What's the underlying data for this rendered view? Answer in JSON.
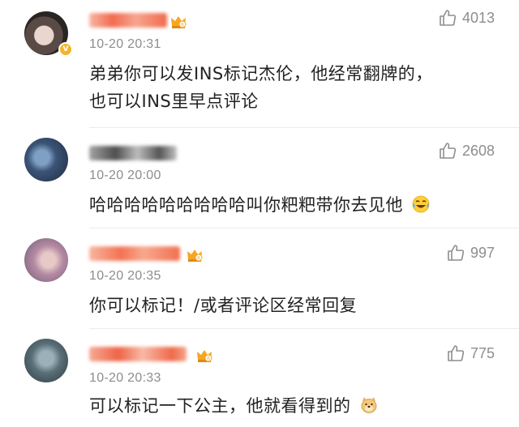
{
  "comments": [
    {
      "time": "10-20 20:31",
      "likes": "4013",
      "text_lines": [
        "弟弟你可以发INS标记杰伦，他经常翻牌的，",
        "也可以INS里早点评论"
      ],
      "has_crown": true,
      "emoji": null
    },
    {
      "time": "10-20 20:00",
      "likes": "2608",
      "text_lines": [
        "哈哈哈哈哈哈哈哈哈叫你粑粑带你去见他"
      ],
      "has_crown": false,
      "emoji": "laughing-tears-emoji"
    },
    {
      "time": "10-20 20:35",
      "likes": "997",
      "text_lines": [
        "你可以标记！/或者评论区经常回复"
      ],
      "has_crown": true,
      "emoji": null
    },
    {
      "time": "10-20 20:33",
      "likes": "775",
      "text_lines": [
        "可以标记一下公主，他就看得到的"
      ],
      "has_crown": true,
      "emoji": "doge-emoji"
    }
  ],
  "colors": {
    "muted": "#8d8d8d",
    "text": "#222222",
    "verified": "#f3b52a",
    "crown": "#f5a623"
  }
}
